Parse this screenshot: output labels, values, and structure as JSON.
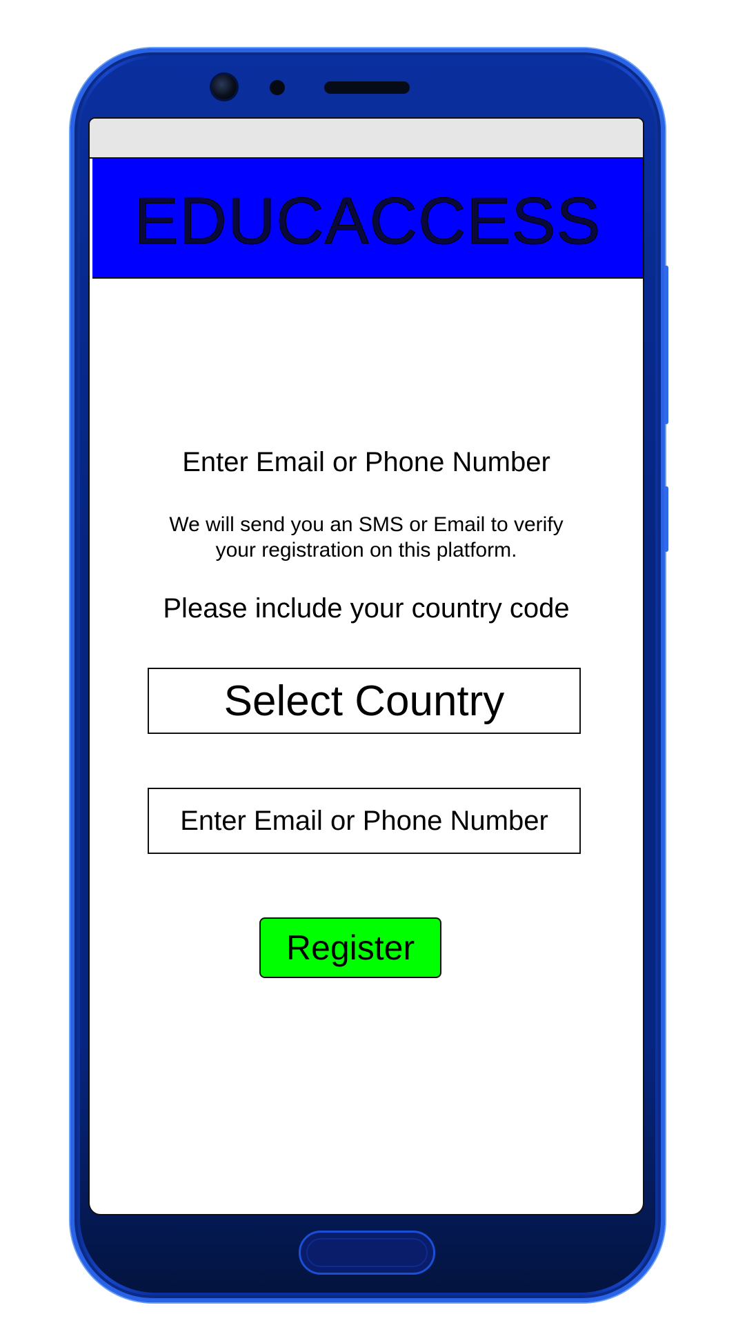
{
  "app": {
    "title": "EDUCACCESS"
  },
  "registration": {
    "heading": "Enter Email or Phone Number",
    "info_line1": "We will send you an SMS or Email to verify",
    "info_line2": "your registration on this platform.",
    "hint": "Please include your country code",
    "country_select_label": "Select Country",
    "contact_placeholder": "Enter Email or Phone Number",
    "register_label": "Register"
  },
  "colors": {
    "header_bg": "#0000ff",
    "register_bg": "#00ff00",
    "phone_frame": "#0b2f9c",
    "status_bar": "#e6e6e6"
  },
  "icons": {
    "front_camera": "front-camera-icon",
    "proximity_sensor": "sensor-icon",
    "earpiece": "speaker-icon",
    "home_button": "home-button-icon"
  }
}
